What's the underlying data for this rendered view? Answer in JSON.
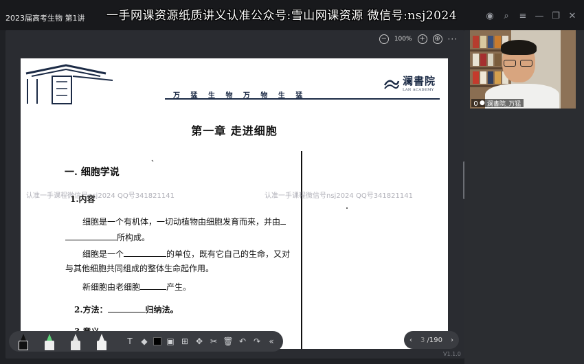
{
  "app": {
    "title": "2023届高考生物  第1讲",
    "banner": "一手网课资源纸质讲义认准公众号:雪山网课资源  微信号:nsj2024"
  },
  "window_controls": [
    "camera-icon",
    "search-icon",
    "menu-icon",
    "minimize-icon",
    "restore-icon",
    "close-icon"
  ],
  "doc_toolbar": {
    "zoom_out": "−",
    "zoom_level": "100%",
    "zoom_in": "+",
    "more": "···"
  },
  "page": {
    "slogan": "万 猛 生 物    万 物 生 猛",
    "logo_cn": "澜書院",
    "logo_en": "LAN ACADEMY",
    "chapter_title": "第一章   走进细胞",
    "tick_mark": "、",
    "section_title": "一. 细胞学说",
    "watermark_left": "认准一手课程微信号nsj2024  QQ号341821141",
    "watermark_right": "认准一手课程微信号nsj2024  QQ号341821141",
    "sub1": "1.内容",
    "p1_pre": "细胞是一个有机体，一切动植物由细胞发育而来，并由",
    "p2_post": "所构成。",
    "p3_pre": "细胞是一个",
    "p3_post": "的单位，既有它自己的生命，又对",
    "p4": "与其他细胞共同组成的整体生命起作用。",
    "p5_pre": "新细胞由老细胞",
    "p5_post": "产生。",
    "sub2_pre": "2.方法：",
    "sub2_post": "归纳法。",
    "sub3": "3.意义"
  },
  "video": {
    "presenter_name": "澜書院_万猛"
  },
  "bottom_toolbar": {
    "pens": [
      {
        "name": "black-pen",
        "color": "#111111"
      },
      {
        "name": "green-highlighter",
        "color": "#5fd07a"
      },
      {
        "name": "eraser-pen",
        "color": "#e8e8e8"
      },
      {
        "name": "white-marker",
        "color": "#f2f2f2"
      }
    ],
    "tools": [
      "text-icon",
      "shape-icon",
      "color-swatch",
      "image-icon",
      "add-icon",
      "move-icon",
      "cut-icon",
      "delete-icon",
      "undo-icon",
      "redo-icon",
      "collapse-icon"
    ]
  },
  "pager": {
    "prev": "‹",
    "current": "3",
    "total": "/190",
    "next": "›"
  },
  "version": "V1.1.0"
}
